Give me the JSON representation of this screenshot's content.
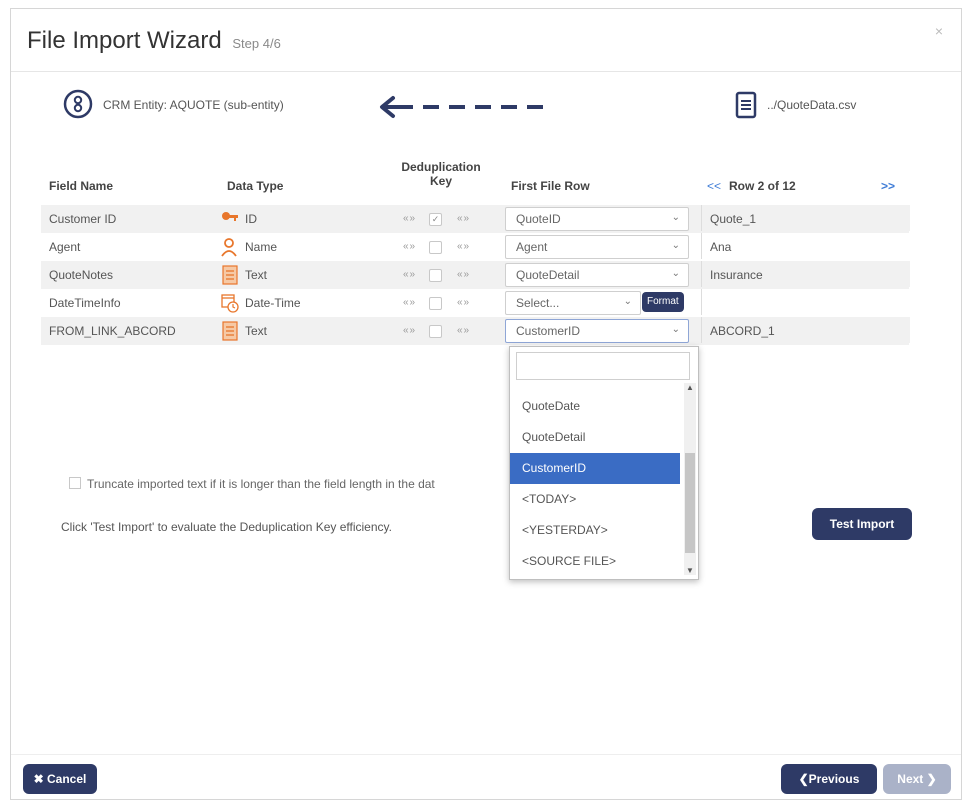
{
  "dialog": {
    "title": "File Import Wizard",
    "step": "Step 4/6",
    "close": "×"
  },
  "mapping": {
    "crm_entity": "CRM Entity: AQUOTE (sub-entity)",
    "file_name": "../QuoteData.csv"
  },
  "table": {
    "headers": {
      "field_name": "Field Name",
      "data_type": "Data Type",
      "dedup_line1": "Deduplication",
      "dedup_line2": "Key",
      "first_file_row": "First File Row",
      "row_nav": "Row 2 of 12",
      "prev": "<<",
      "next": ">>"
    },
    "rows": [
      {
        "field": "Customer ID",
        "type": "ID",
        "type_icon": "key-icon",
        "dedup_checked": true,
        "mapping": "QuoteID",
        "sample": "Quote_1"
      },
      {
        "field": "Agent",
        "type": "Name",
        "type_icon": "person-icon",
        "dedup_checked": false,
        "mapping": "Agent",
        "sample": "Ana"
      },
      {
        "field": "QuoteNotes",
        "type": "Text",
        "type_icon": "text-document-icon",
        "dedup_checked": false,
        "mapping": "QuoteDetail",
        "sample": "Insurance"
      },
      {
        "field": "DateTimeInfo",
        "type": "Date-Time",
        "type_icon": "calendar-clock-icon",
        "dedup_checked": false,
        "mapping": "Select...",
        "sample": "",
        "format_button": "Format"
      },
      {
        "field": "FROM_LINK_ABCORD",
        "type": "Text",
        "type_icon": "text-document-icon",
        "dedup_checked": false,
        "mapping": "CustomerID",
        "sample": "ABCORD_1"
      }
    ],
    "arrow_glyph": "«»"
  },
  "dropdown": {
    "search_value": "",
    "items": [
      "QuoteDate",
      "QuoteDetail",
      "CustomerID",
      "<TODAY>",
      "<YESTERDAY>",
      "<SOURCE FILE>"
    ],
    "selected": "CustomerID"
  },
  "options": {
    "truncate_label": "Truncate imported text if it is longer than the field length in the dat",
    "hint": "Click 'Test Import' to evaluate the Deduplication Key efficiency.",
    "test_import": "Test Import"
  },
  "footer": {
    "cancel": "Cancel",
    "previous": "Previous",
    "next": "Next"
  },
  "colors": {
    "primary_button": "#2e3a66",
    "link": "#3d7bd6",
    "selected_item": "#3a6cc4"
  }
}
